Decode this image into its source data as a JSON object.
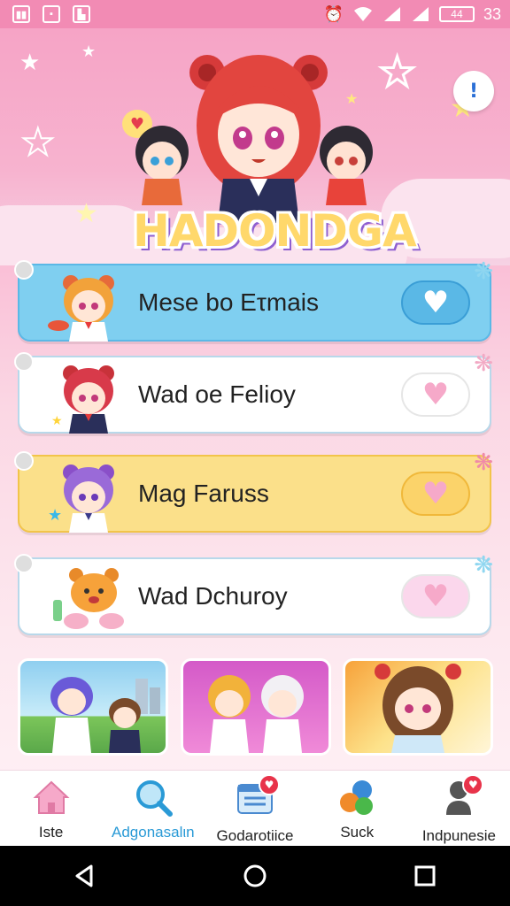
{
  "statusbar": {
    "left_icons": [
      "notification-icon-1",
      "notification-icon-2",
      "notification-icon-3"
    ],
    "battery_level": "44",
    "time": "33"
  },
  "header": {
    "logo_text": "HADONDGA",
    "info_glyph": "!"
  },
  "list_items": [
    {
      "label": "Mese bo Eτmais",
      "background": "#7fcff0",
      "heart_bg": "#5ab8e6",
      "heart_color": "#ffffff",
      "sparkle_color": "#8fd6f0"
    },
    {
      "label": "Wad oe Feliοy",
      "background": "#ffffff",
      "heart_bg": "#ffffff",
      "heart_color": "#f6a9c9",
      "sparkle_color": "#f2a9c4"
    },
    {
      "label": "Mag Faruss",
      "background": "#fbe08a",
      "heart_bg": "#fbd36a",
      "heart_color": "#f6a9c9",
      "sparkle_color": "#f08aa8"
    },
    {
      "label": "Wad Dchuroy",
      "background": "#ffffff",
      "heart_bg": "#fbd7ec",
      "heart_color": "#f6a9c9",
      "sparkle_color": "#8fd6f0"
    }
  ],
  "bottom_nav": [
    {
      "label": "Iste",
      "icon": "home-icon",
      "active": false,
      "badge": ""
    },
    {
      "label": "Adgonasalιn",
      "icon": "search-icon",
      "active": true,
      "badge": ""
    },
    {
      "label": "Godarotiice",
      "icon": "calendar-icon",
      "active": false,
      "badge": "♥"
    },
    {
      "label": "Suck",
      "icon": "palette-icon",
      "active": false,
      "badge": ""
    },
    {
      "label": "Indpunesie",
      "icon": "profile-icon",
      "active": false,
      "badge": "♥"
    }
  ],
  "colors": {
    "accent": "#f28bb4",
    "active_nav": "#2a9ad6"
  }
}
